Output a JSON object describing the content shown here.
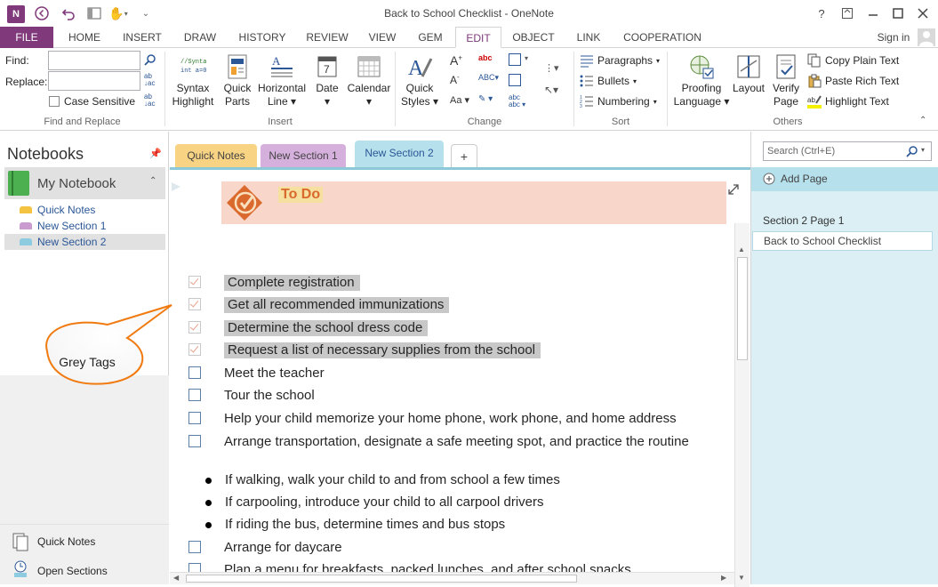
{
  "app": {
    "title": "Back to School Checklist - OneNote",
    "signin": "Sign in"
  },
  "tabs": [
    "FILE",
    "HOME",
    "INSERT",
    "DRAW",
    "HISTORY",
    "REVIEW",
    "VIEW",
    "GEM",
    "EDIT",
    "OBJECT",
    "LINK",
    "COOPERATION"
  ],
  "window_buttons": {
    "help": "?",
    "restore_ribbon": "▫",
    "minimize": "—",
    "maximize": "☐",
    "close": "✕"
  },
  "find_replace": {
    "find_label": "Find:",
    "replace_label": "Replace:",
    "case_sensitive": "Case Sensitive",
    "group": "Find and Replace"
  },
  "insert_group": {
    "syntax": "Syntax\nHighlight",
    "quick_parts": "Quick\nParts",
    "horizontal_line": "Horizontal\nLine ▾",
    "date": "Date\n▾",
    "calendar": "Calendar\n▾",
    "group": "Insert"
  },
  "change_group": {
    "quick_styles": "Quick\nStyles ▾",
    "group": "Change"
  },
  "sort_group": {
    "paragraphs": "Paragraphs",
    "bullets": "Bullets",
    "numbering": "Numbering",
    "group": "Sort"
  },
  "others_group": {
    "proofing": "Proofing\nLanguage ▾",
    "layout": "Layout",
    "verify": "Verify\nPage",
    "copy_plain": "Copy Plain Text",
    "paste_rich": "Paste Rich Text",
    "highlight": "Highlight Text",
    "group": "Others"
  },
  "notebooks": {
    "header": "Notebooks",
    "notebook": "My Notebook",
    "sections": [
      {
        "label": "Quick Notes",
        "color": "#f5c342"
      },
      {
        "label": "New Section 1",
        "color": "#c99bcf"
      },
      {
        "label": "New Section 2",
        "color": "#8ccbe0"
      }
    ],
    "footer_quick": "Quick Notes",
    "footer_open": "Open Sections"
  },
  "section_tabs": [
    {
      "label": "Quick Notes",
      "color": "#f7d383"
    },
    {
      "label": "New Section 1",
      "color": "#d6b0dc"
    },
    {
      "label": "New Section 2",
      "color": "#b6e0ec"
    },
    {
      "label": "+",
      "color": "#ffffff"
    }
  ],
  "page": {
    "title": "To Do",
    "items": [
      {
        "type": "check",
        "done": true,
        "text": "Complete registration"
      },
      {
        "type": "check",
        "done": true,
        "text": "Get all recommended immunizations"
      },
      {
        "type": "check",
        "done": true,
        "text": "Determine the school dress code"
      },
      {
        "type": "check",
        "done": true,
        "text": "Request a list of necessary supplies from the school"
      },
      {
        "type": "check",
        "done": false,
        "text": "Meet the teacher"
      },
      {
        "type": "check",
        "done": false,
        "text": "Tour the school"
      },
      {
        "type": "check",
        "done": false,
        "text": "Help your child memorize your home phone, work phone, and home address"
      },
      {
        "type": "check",
        "done": false,
        "text": "Arrange transportation, designate a safe meeting spot, and practice the routine"
      },
      {
        "type": "bullet",
        "text": "If walking, walk your child to and from school a few times"
      },
      {
        "type": "bullet",
        "text": "If carpooling, introduce your child to all carpool drivers"
      },
      {
        "type": "bullet",
        "text": "If riding the bus, determine times and bus stops"
      },
      {
        "type": "check",
        "done": false,
        "text": "Arrange for daycare"
      },
      {
        "type": "check",
        "done": false,
        "text": "Plan a menu for breakfasts, packed lunches, and after school snacks"
      }
    ],
    "callout": "Grey Tags"
  },
  "right": {
    "search_placeholder": "Search (Ctrl+E)",
    "add_page": "Add Page",
    "section_title": "Section 2 Page 1",
    "page_item": "Back to School Checklist"
  }
}
